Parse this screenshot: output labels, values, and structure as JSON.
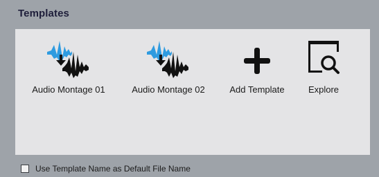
{
  "panel": {
    "title": "Templates"
  },
  "templates": [
    {
      "label": "Audio Montage 01",
      "icon": "audio-montage-icon"
    },
    {
      "label": "Audio Montage 02",
      "icon": "audio-montage-icon"
    },
    {
      "label": "Add Template",
      "icon": "plus-icon"
    },
    {
      "label": "Explore",
      "icon": "explore-search-icon"
    }
  ],
  "footer": {
    "checkbox_label": "Use Template Name as Default File Name",
    "checked": false
  },
  "colors": {
    "background": "#9ea3a9",
    "content_bg": "#e4e4e6",
    "wave_blue": "#2e9be0",
    "wave_dark": "#111111",
    "title": "#1e1e3a"
  }
}
